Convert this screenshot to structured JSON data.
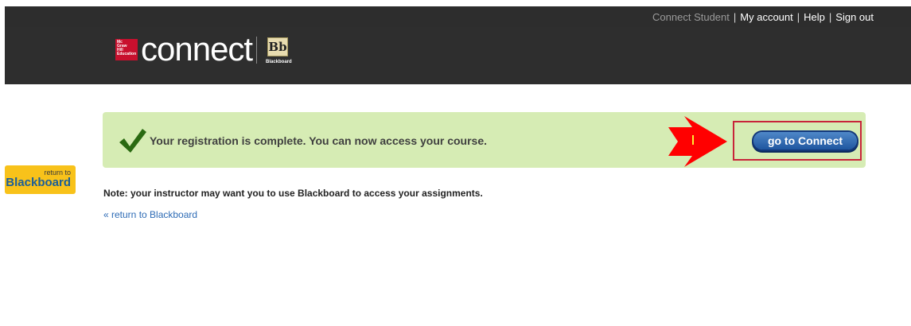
{
  "top_nav": {
    "user_type": "Connect Student",
    "my_account": "My account",
    "help": "Help",
    "sign_out": "Sign out",
    "separator": "|"
  },
  "header": {
    "publisher_logo": [
      "Mc",
      "Graw",
      "Hill",
      "Education"
    ],
    "brand": "connect",
    "partner_logo": "Bb",
    "partner_name": "Blackboard"
  },
  "side_tab": {
    "small": "return to",
    "big": "Blackboard"
  },
  "banner": {
    "message": "Your registration is complete. You can now access your course.",
    "button": "go to Connect",
    "colors": {
      "background": "#d6ecb4",
      "button": "#1f56a0",
      "arrow": "#ff0000"
    }
  },
  "note": "Note: your instructor may want you to use Blackboard to access your assignments.",
  "return_link": "« return to Blackboard",
  "icons": {
    "check": "check-icon",
    "arrow": "red-arrow-icon",
    "cursor": "text-cursor-icon"
  }
}
